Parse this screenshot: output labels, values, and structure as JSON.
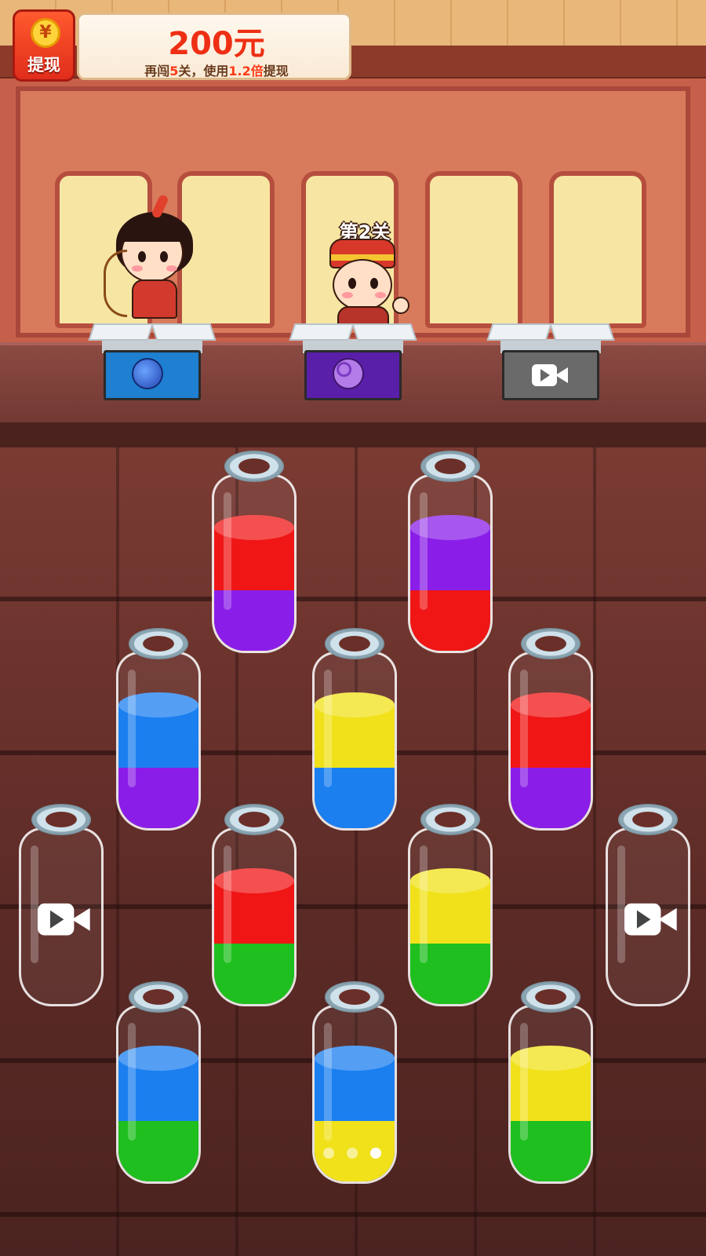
{
  "reward": {
    "icon": "yuan-coin-icon",
    "coin_symbol": "¥",
    "withdraw_label": "提现",
    "amount": "200元",
    "progress_prefix": "再闯",
    "levels_remaining": "5",
    "progress_mid": "关，使用",
    "multiplier": "1.2倍",
    "progress_suffix": "提现"
  },
  "level": {
    "label": "第2关"
  },
  "characters": [
    {
      "name": "archer-girl"
    },
    {
      "name": "official-boy"
    }
  ],
  "collection_boxes": [
    {
      "item": "blueberry",
      "icon": "blueberry-icon",
      "color": "#1f7fd1",
      "locked": false
    },
    {
      "item": "grape",
      "icon": "grape-icon",
      "color": "#5a1fa8",
      "locked": false
    },
    {
      "item": "video-unlock",
      "icon": "video-icon",
      "color": "#6a6a6a",
      "locked": true
    }
  ],
  "colors": {
    "red": "#f01616",
    "purple": "#8a1ee8",
    "blue": "#1b7ff0",
    "yellow": "#f0e11a",
    "green": "#1fbf1f"
  },
  "bottles": [
    {
      "id": "b1",
      "layers": [
        "purple",
        "red"
      ],
      "locked": false
    },
    {
      "id": "b2",
      "layers": [
        "red",
        "purple"
      ],
      "locked": false
    },
    {
      "id": "b3",
      "layers": [
        "purple",
        "blue"
      ],
      "locked": false
    },
    {
      "id": "b4",
      "layers": [
        "blue",
        "yellow"
      ],
      "locked": false
    },
    {
      "id": "b5",
      "layers": [
        "purple",
        "red"
      ],
      "locked": false
    },
    {
      "id": "b6",
      "layers": [],
      "locked": true,
      "icon": "video-icon"
    },
    {
      "id": "b7",
      "layers": [
        "green",
        "red"
      ],
      "locked": false
    },
    {
      "id": "b8",
      "layers": [
        "green",
        "yellow"
      ],
      "locked": false
    },
    {
      "id": "b9",
      "layers": [],
      "locked": true,
      "icon": "video-icon"
    },
    {
      "id": "b10",
      "layers": [
        "green",
        "blue"
      ],
      "locked": false
    },
    {
      "id": "b11",
      "layers": [
        "yellow",
        "blue"
      ],
      "locked": false
    },
    {
      "id": "b12",
      "layers": [
        "green",
        "yellow"
      ],
      "locked": false
    }
  ],
  "page_indicator": {
    "count": 3,
    "active": 3
  }
}
